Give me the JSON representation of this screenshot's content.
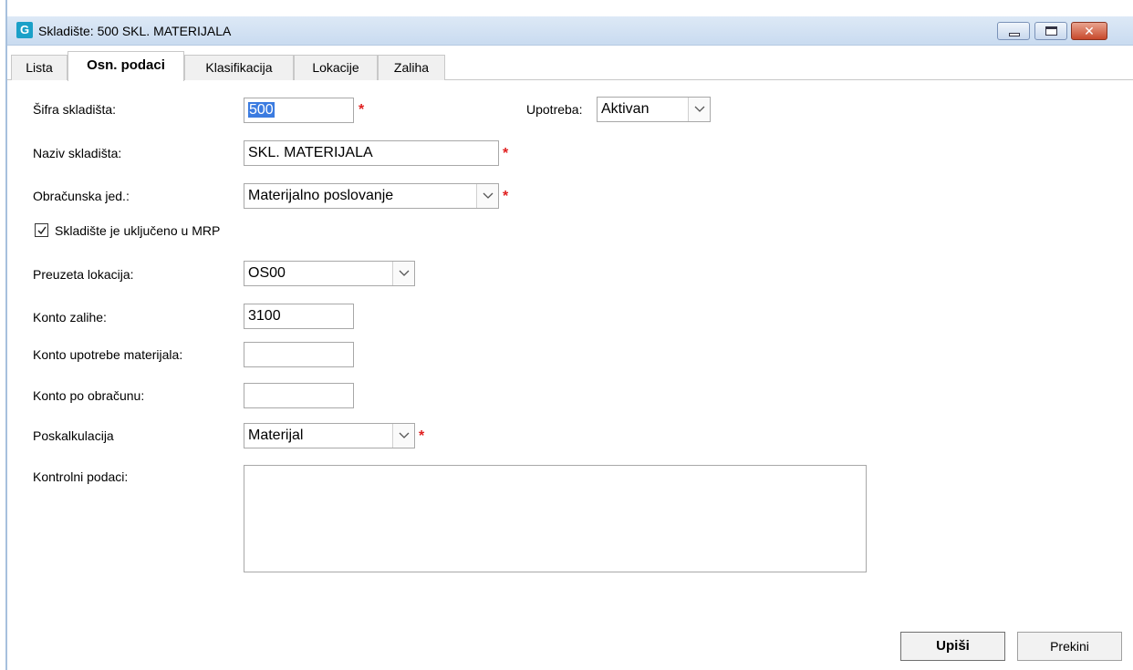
{
  "window": {
    "title": "Skladište: 500 SKL. MATERIJALA",
    "app_icon_letter": "G",
    "close_glyph": "✕"
  },
  "tabs": [
    {
      "label": "Lista"
    },
    {
      "label": "Osn. podaci",
      "active": true
    },
    {
      "label": "Klasifikacija"
    },
    {
      "label": "Lokacije"
    },
    {
      "label": "Zaliha"
    }
  ],
  "form": {
    "sifra": {
      "label": "Šifra skladišta:",
      "value": "500",
      "required_mark": "*"
    },
    "upotreba": {
      "label": "Upotreba:",
      "value": "Aktivan"
    },
    "naziv": {
      "label": "Naziv skladišta:",
      "value": "SKL. MATERIJALA",
      "required_mark": "*"
    },
    "obracunska": {
      "label": "Obračunska jed.:",
      "value": "Materijalno poslovanje",
      "required_mark": "*"
    },
    "mrp": {
      "label": "Skladište je uključeno u MRP",
      "checked": true
    },
    "lokacija": {
      "label": "Preuzeta lokacija:",
      "value": "OS00"
    },
    "konto_zalihe": {
      "label": "Konto zalihe:",
      "value": "3100"
    },
    "konto_upotrebe": {
      "label": "Konto upotrebe materijala:",
      "value": ""
    },
    "konto_obracun": {
      "label": "Konto po obračunu:",
      "value": ""
    },
    "poskalkulacija": {
      "label": "Poskalkulacija",
      "value": "Materijal",
      "required_mark": "*"
    },
    "kontrolni": {
      "label": "Kontrolni podaci:",
      "value": ""
    }
  },
  "buttons": {
    "save": "Upiši",
    "cancel": "Prekini"
  },
  "colors": {
    "required": "#e02020",
    "selection": "#3b7be0",
    "titlebar": "#c9dbf0"
  }
}
